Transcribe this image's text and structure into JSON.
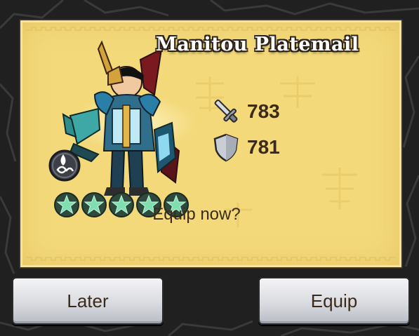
{
  "dialog": {
    "item_name": "Manitou Platemail",
    "attack_value": "783",
    "defense_value": "781",
    "prompt": "Equip now?",
    "stars": 5,
    "star_color": "#6ed3a3",
    "element_icon": "water-element-icon"
  },
  "buttons": {
    "later_label": "Later",
    "equip_label": "Equip"
  },
  "colors": {
    "panel": "#f3d97a",
    "text": "#3b2a1a",
    "background": "#1f1f1f"
  }
}
